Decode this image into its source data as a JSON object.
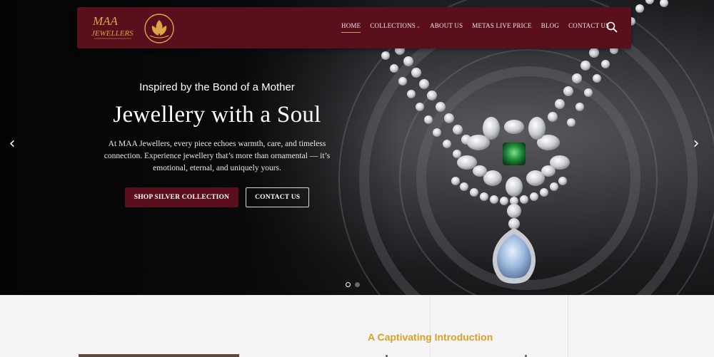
{
  "brand": {
    "line1": "MAA",
    "line2": "JEWELLERS",
    "colors": {
      "maroon": "#5a0f1c",
      "gold": "#d9a027"
    }
  },
  "nav": {
    "items": [
      {
        "label": "HOME",
        "active": true
      },
      {
        "label": "COLLECTIONS",
        "has_dropdown": true
      },
      {
        "label": "ABOUT US"
      },
      {
        "label": "METAS LIVE PRICE"
      },
      {
        "label": "BLOG"
      },
      {
        "label": "CONTACT US"
      }
    ],
    "search_icon": "search-icon",
    "dropdown_icon": "chevron-down-icon"
  },
  "hero": {
    "tagline": "Inspired by the Bond of a Mother",
    "headline": "Jewellery with a Soul",
    "description": "At MAA Jewellers, every piece echoes warmth, care, and timeless connection. Experience jewellery that’s more than ornamental — it’s emotional, eternal, and uniquely yours.",
    "primary_cta": "SHOP SILVER COLLECTION",
    "secondary_cta": "CONTACT US",
    "prev_icon": "‹",
    "next_icon": "›",
    "slides": {
      "current": 1,
      "total": 2
    }
  },
  "intro": {
    "title": "A Captivating Introduction"
  }
}
